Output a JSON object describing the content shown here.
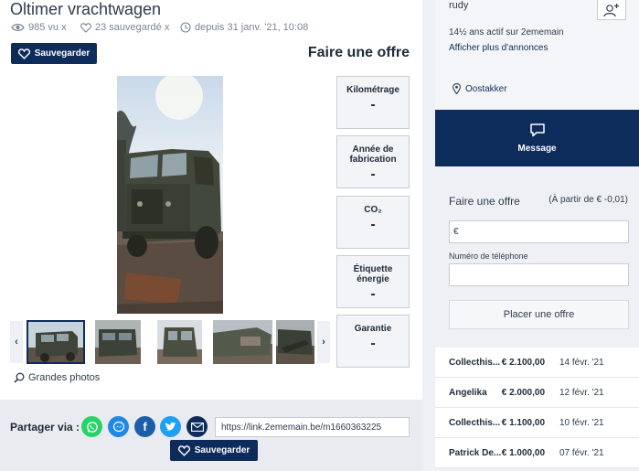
{
  "listing": {
    "title": "Oltimer vrachtwagen",
    "views": "985 vu x",
    "saves": "23 sauvegardé x",
    "since": "depuis 31 janv. '21, 10:08"
  },
  "buttons": {
    "save_label": "Sauvegarder"
  },
  "offer_heading": "Faire une offre",
  "specs": [
    {
      "label": "Kilométrage",
      "value": "-"
    },
    {
      "label": "Année de fabrication",
      "value": "-"
    },
    {
      "label": "CO₂",
      "value": "-"
    },
    {
      "label": "Étiquette énergie",
      "value": "-"
    },
    {
      "label": "Garantie",
      "value": "-"
    }
  ],
  "gallery": {
    "prev": "‹",
    "next": "›",
    "big_photos": "Grandes photos"
  },
  "share": {
    "label": "Partager via :",
    "link": "https://link.2ememain.be/m1660363225"
  },
  "seller": {
    "name": "rudy",
    "active_since": "14½ ans actif sur 2ememain",
    "more_ads": "Afficher plus d'annonces",
    "location": "Oostakker"
  },
  "message_label": "Message",
  "offer_form": {
    "title": "Faire une offre",
    "minimum": "(À partir de € -0,01)",
    "currency": "€",
    "phone_label": "Numéro de téléphone",
    "submit": "Placer une offre"
  },
  "bids": [
    {
      "bidder": "Collecthis...",
      "amount": "€ 2.100,00",
      "date": "14 févr. '21"
    },
    {
      "bidder": "Angelika",
      "amount": "€ 2.000,00",
      "date": "12 févr. '21"
    },
    {
      "bidder": "Collecthis...",
      "amount": "€ 1.100,00",
      "date": "10 févr. '21"
    },
    {
      "bidder": "Patrick De...",
      "amount": "€ 1.000,00",
      "date": "07 févr. '21"
    }
  ],
  "colors": {
    "brand": "#0e2c5b",
    "whatsapp": "#25d366",
    "messenger": "#1e88e5",
    "facebook": "#1b5fa8",
    "twitter": "#1da1f2",
    "email": "#0e2c5b"
  }
}
